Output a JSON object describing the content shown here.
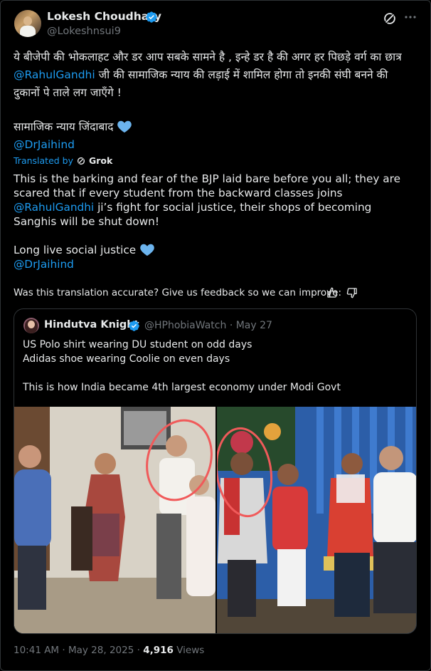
{
  "tweet": {
    "author_name": "Lokesh Choudhary",
    "author_handle": "@Lokeshnsui9",
    "original_lines": [
      "ये बीजेपी की भोकलाहट और डर आप सबके सामने है , इन्हे डर है की अगर हर पिछड़े वर्ग का छात्र",
      "जी की सामाजिक न्याय की लड़ाई में शामिल होगा तो इनकी संघी बनने की",
      "दुकानों पे ताले लग जाएँगे !"
    ],
    "original_mention": "@RahulGandhi",
    "original_slogan": "सामाजिक न्याय जिंदाबाद",
    "original_tag": "@DrJaihind",
    "translated_by": "Translated by",
    "translated_engine": "Grok",
    "translation_lines": [
      "This is the barking and fear of the BJP laid bare before you all; they are",
      "scared that if every student from the backward classes joins",
      "ji’s fight for social justice, their shops of becoming",
      "Sanghis will be shut down!"
    ],
    "translation_mention": "@RahulGandhi",
    "translation_slogan": "Long live social justice",
    "translation_tag": "@DrJaihind",
    "feedback_prompt": "Was this translation accurate? Give us feedback so we can improve:",
    "time": "10:41 AM",
    "separator": "·",
    "date": "May 28, 2025",
    "views_count": "4,916",
    "views_label": "Views"
  },
  "quoted": {
    "author_name": "Hindutva Knight",
    "author_handle": "@HPhobiaWatch",
    "date": "May 27",
    "separator": "·",
    "lines": [
      "US Polo shirt wearing DU student on odd days",
      "Adidas shoe wearing Coolie on even days",
      "This is how India became 4th largest economy under Modi Govt"
    ]
  },
  "colors": {
    "accent": "#1d9bf0",
    "heart": "#6cb4ee",
    "annotation_circle": "#f05a5a"
  },
  "icons": [
    "verified-badge-icon",
    "grok-icon",
    "more-icon",
    "heart-icon",
    "thumbs-up-icon",
    "thumbs-down-icon"
  ]
}
